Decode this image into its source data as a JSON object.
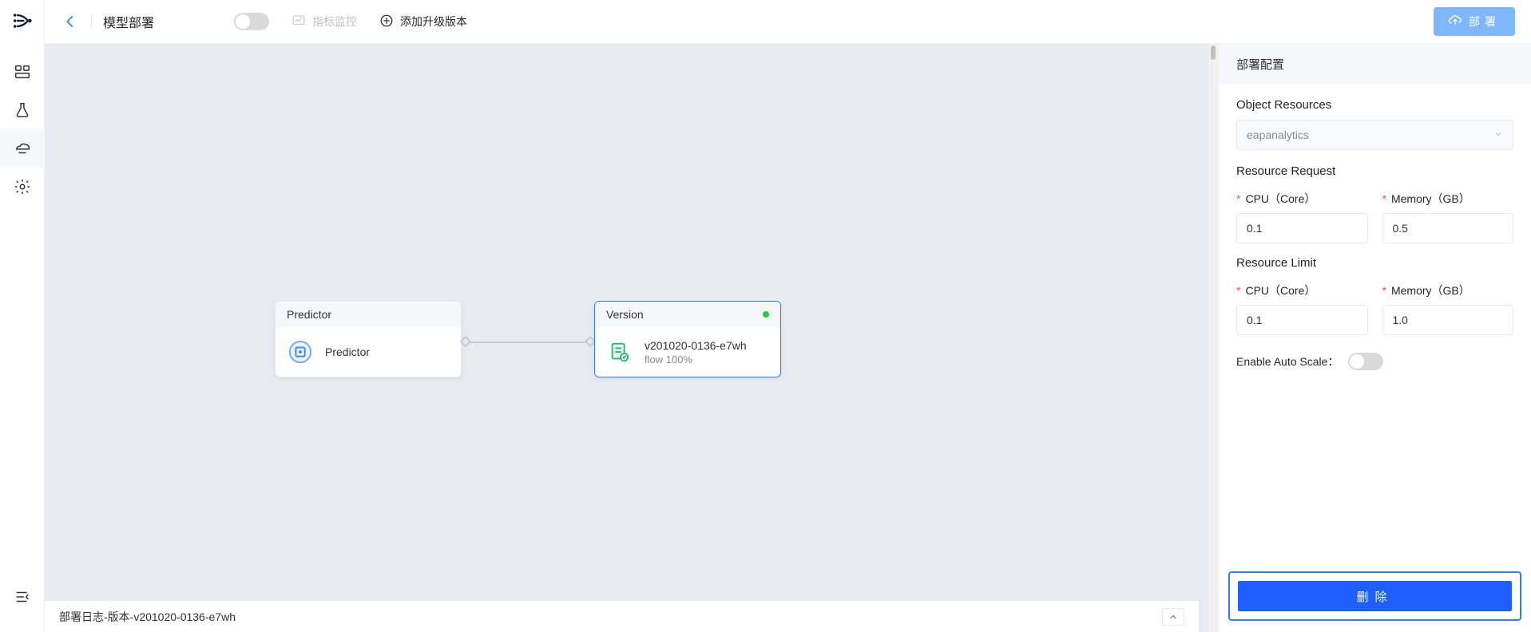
{
  "header": {
    "page_title": "模型部署",
    "monitor_label": "指标监控",
    "add_version_label": "添加升级版本",
    "deploy_label": "部署"
  },
  "sidebar": {
    "items": [
      {
        "name": "panel-icon"
      },
      {
        "name": "flask-icon"
      },
      {
        "name": "layers-icon"
      },
      {
        "name": "gear-icon"
      }
    ],
    "active_index": 2
  },
  "canvas": {
    "predictor_card": {
      "head": "Predictor",
      "title": "Predictor"
    },
    "version_card": {
      "head": "Version",
      "title": "v201020-0136-e7wh",
      "subtitle": "flow 100%",
      "status": "green"
    }
  },
  "log_bar": {
    "text": "部署日志-版本-v201020-0136-e7wh"
  },
  "config": {
    "panel_title": "部署配置",
    "obj_res_label": "Object Resources",
    "obj_res_value": "eapanalytics",
    "request_title": "Resource Request",
    "limit_title": "Resource Limit",
    "cpu_label": "CPU（Core）",
    "mem_label": "Memory（GB）",
    "req_cpu": "0.1",
    "req_mem": "0.5",
    "lim_cpu": "0.1",
    "lim_mem": "1.0",
    "autoscale_label": "Enable Auto Scale：",
    "delete_label": "删除"
  }
}
